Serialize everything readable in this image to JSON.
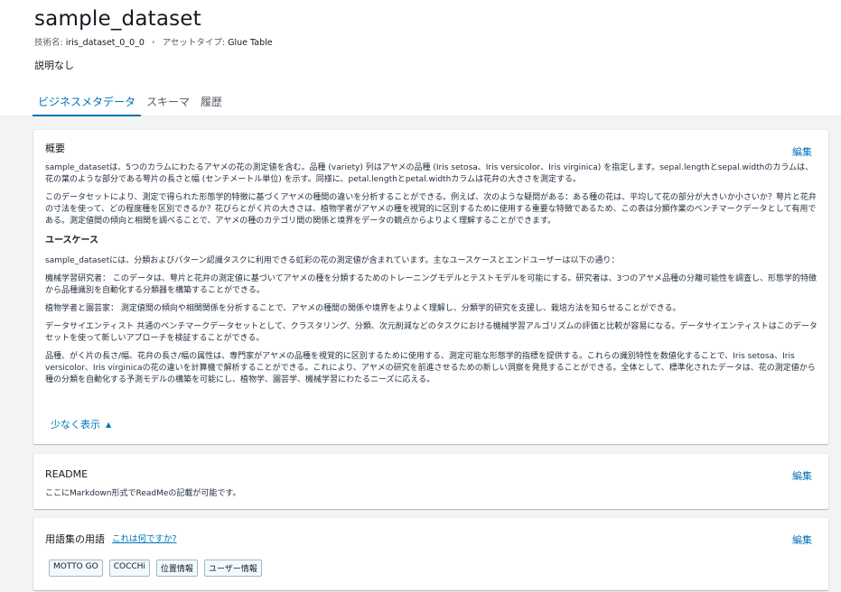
{
  "asset": {
    "title": "sample_dataset",
    "tech_name_label": "技術名:",
    "tech_name": "iris_dataset_0_0_0",
    "asset_type_label": "アセットタイプ:",
    "asset_type": "Glue Table",
    "description": "説明なし"
  },
  "tabs": [
    {
      "label": "ビジネスメタデータ",
      "active": true
    },
    {
      "label": "スキーマ",
      "active": false
    },
    {
      "label": "履歴",
      "active": false
    }
  ],
  "overview": {
    "heading": "概要",
    "edit_label": "編集",
    "p1": "sample_datasetは、5つのカラムにわたるアヤメの花の測定値を含む。品種 (variety) 列はアヤメの品種 (Iris setosa、Iris versicolor、Iris virginica) を指定します。sepal.lengthとsepal.widthのカラムは、花の葉のような部分である萼片の長さと幅 (センチメートル単位) を示す。同様に、petal.lengthとpetal.widthカラムは花弁の大きさを測定する。",
    "p2": "このデータセットにより、測定で得られた形態学的特徴に基づくアヤメの種間の違いを分析することができる。例えば、次のような疑問がある：ある種の花は、平均して花の部分が大きいか小さいか？萼片と花弁の寸法を使って、どの程度種を区別できるか？花びらとがく片の大きさは、植物学者がアヤメの種を視覚的に区別するために使用する重要な特徴であるため、この表は分類作業のベンチマークデータとして有用である。測定値間の傾向と相関を調べることで、アヤメの種のカテゴリ間の関係と境界をデータの観点からよりよく理解することができます。",
    "usecase_heading": "ユースケース",
    "p3": "sample_datasetには、分類およびパターン認識タスクに利用できる虹彩の花の測定値が含まれています。主なユースケースとエンドユーザーは以下の通り：",
    "p4": "機械学習研究者： このデータは、萼片と花弁の測定値に基づいてアヤメの種を分類するためのトレーニングモデルとテストモデルを可能にする。研究者は、3つのアヤメ品種の分離可能性を調査し、形態学的特徴から品種識別を自動化する分類器を構築することができる。",
    "p5": "植物学者と園芸家： 測定値間の傾向や相関関係を分析することで、アヤメの種間の関係や境界をよりよく理解し、分類学的研究を支援し、栽培方法を知らせることができる。",
    "p6": "データサイエンティスト 共通のベンチマークデータセットとして、クラスタリング、分類、次元削減などのタスクにおける機械学習アルゴリズムの評価と比較が容易になる。データサイエンティストはこのデータセットを使って新しいアプローチを検証することができる。",
    "p7": "品種、がく片の長さ/幅、花弁の長さ/幅の属性は、専門家がアヤメの品種を視覚的に区別するために使用する、測定可能な形態学的指標を提供する。これらの識別特性を数値化することで、Iris setosa、Iris versicolor、Iris virginicaの花の違いを計算機で解析することができる。これにより、アヤメの研究を前進させるための新しい洞察を発見することができる。全体として、標準化されたデータは、花の測定値から種の分類を自動化する予測モデルの構築を可能にし、植物学、園芸学、機械学習にわたるニーズに応える。",
    "show_less": "少なく表示",
    "show_less_icon": "caret-up-icon"
  },
  "readme": {
    "heading": "README",
    "edit_label": "編集",
    "text": "ここにMarkdown形式でReadMeの記載が可能です。"
  },
  "glossary": {
    "heading": "用語集の用語",
    "what_link": "これは何ですか?",
    "edit_label": "編集",
    "terms": [
      "MOTTO GO",
      "COCCHi",
      "位置情報",
      "ユーザー情報"
    ]
  },
  "colors": {
    "link": "#0073bb",
    "background": "#f2f3f3",
    "tag_bg": "#f1faff"
  }
}
